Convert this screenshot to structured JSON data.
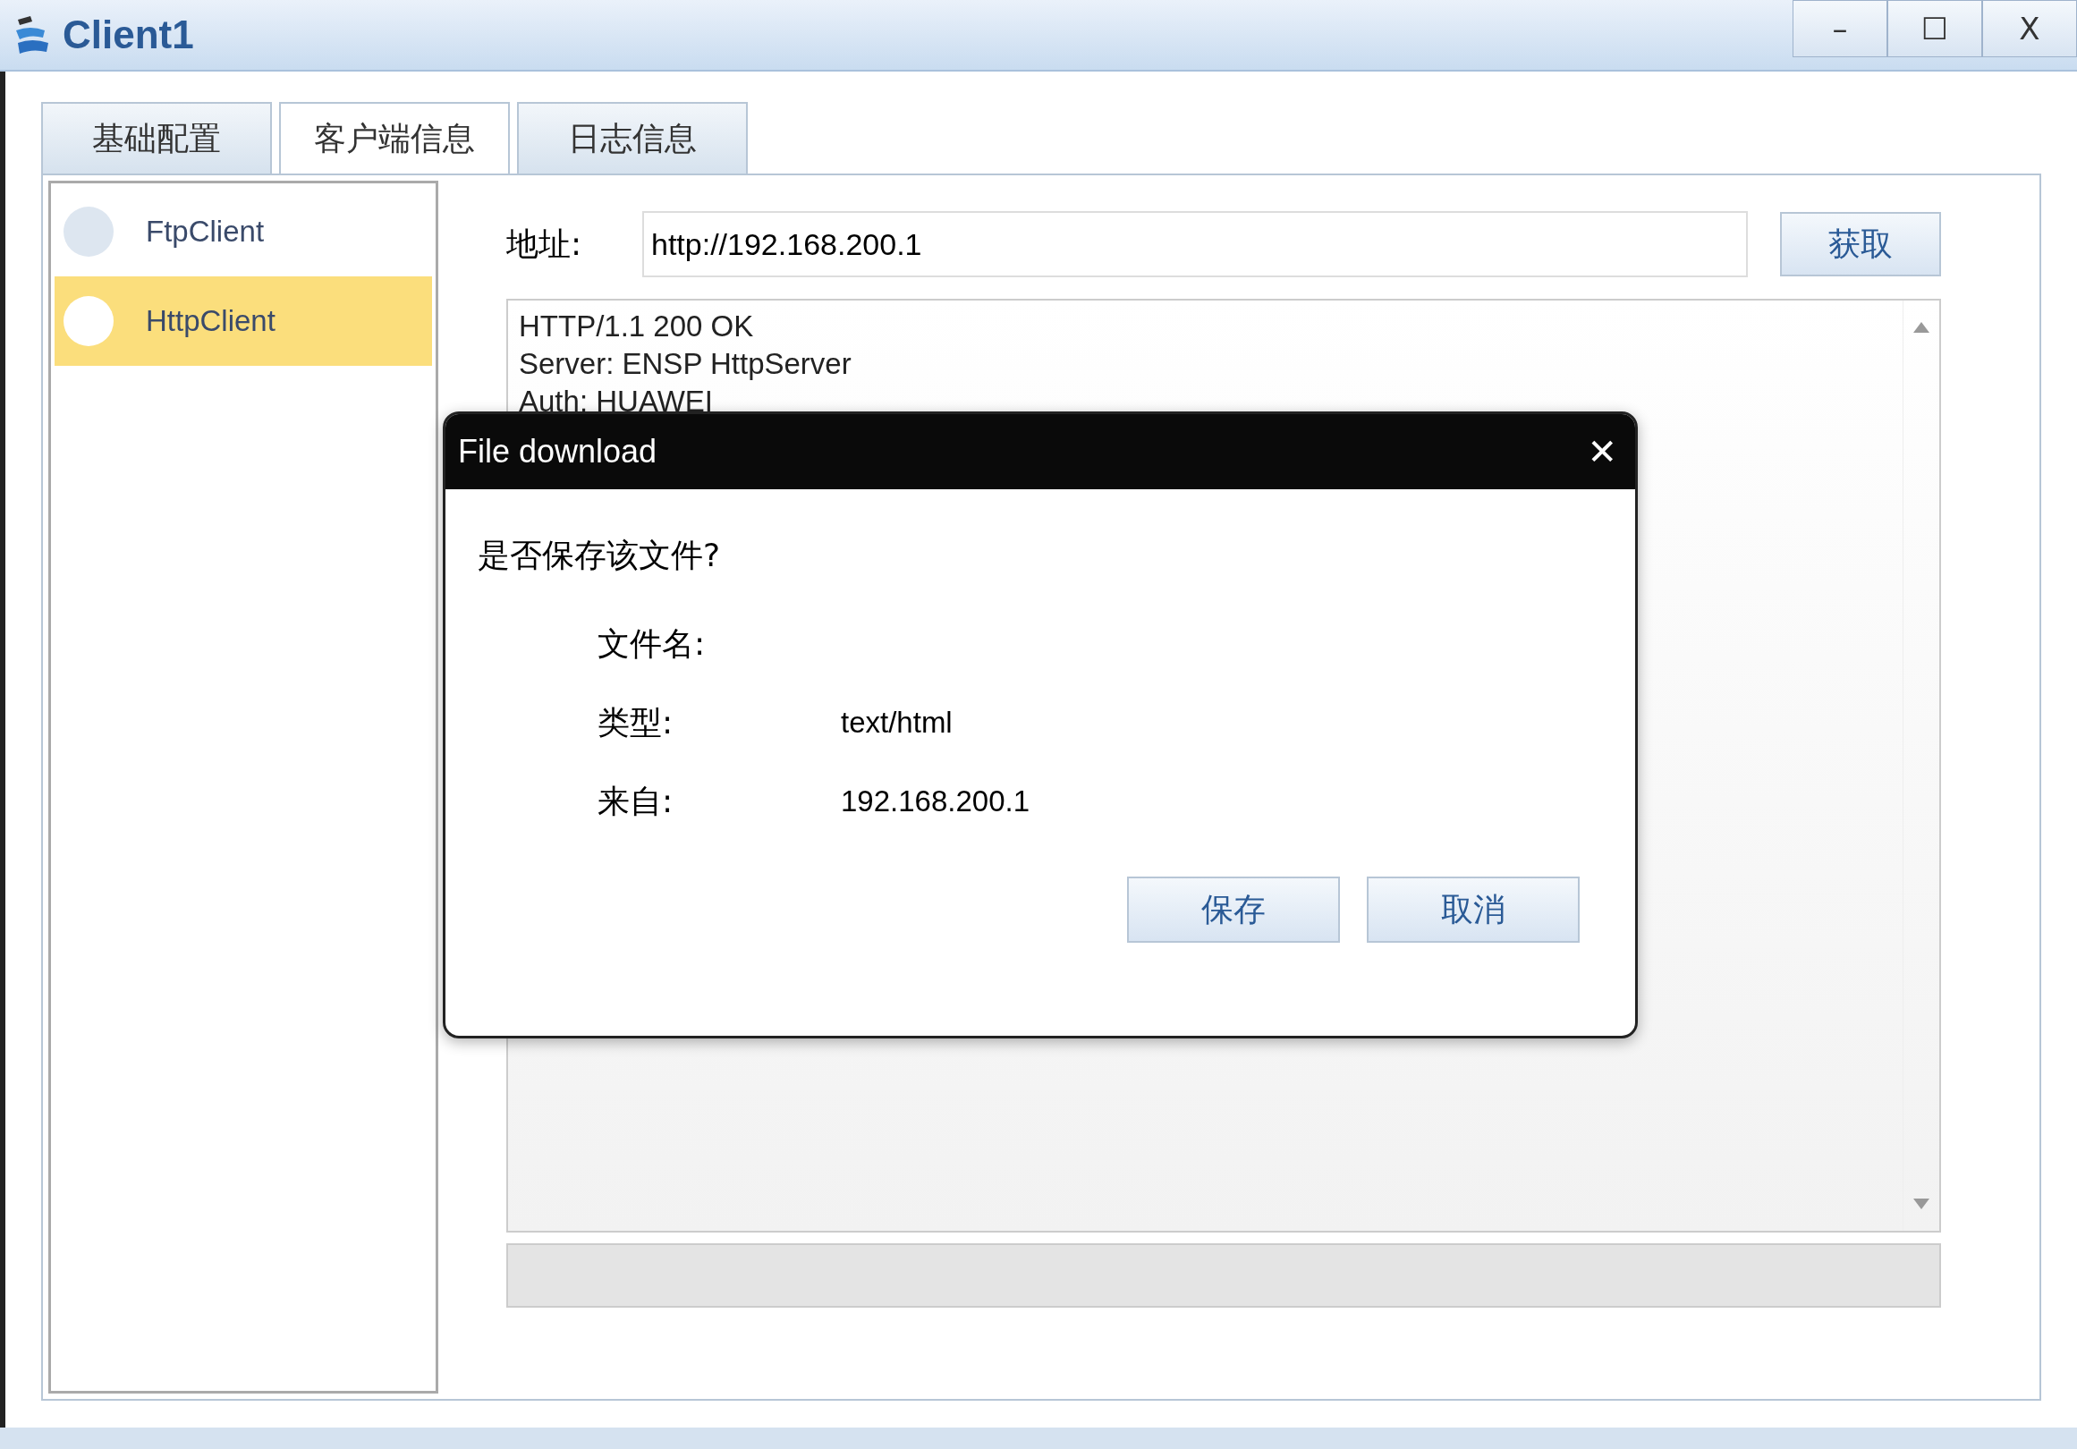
{
  "window": {
    "title": "Client1",
    "controls": [
      "–",
      "☐",
      "X"
    ]
  },
  "tabs": [
    {
      "label": "基础配置",
      "selected": false
    },
    {
      "label": "客户端信息",
      "selected": true
    },
    {
      "label": "日志信息",
      "selected": false
    }
  ],
  "sidebar": {
    "items": [
      {
        "label": "FtpClient",
        "selected": false
      },
      {
        "label": "HttpClient",
        "selected": true
      }
    ]
  },
  "address": {
    "label": "地址:",
    "value": "http://192.168.200.1",
    "button": "获取"
  },
  "response": {
    "lines": [
      "HTTP/1.1 200 OK",
      "Server: ENSP HttpServer",
      "Auth: HUAWEI"
    ]
  },
  "dialog": {
    "title": "File download",
    "close": "✕",
    "question": "是否保存该文件?",
    "fields": [
      {
        "label": "文件名:"
      },
      {
        "label": "类型:",
        "value": "text/html"
      },
      {
        "label": "来自:",
        "value": "192.168.200.1"
      }
    ],
    "buttons": [
      "保存",
      "取消"
    ]
  }
}
